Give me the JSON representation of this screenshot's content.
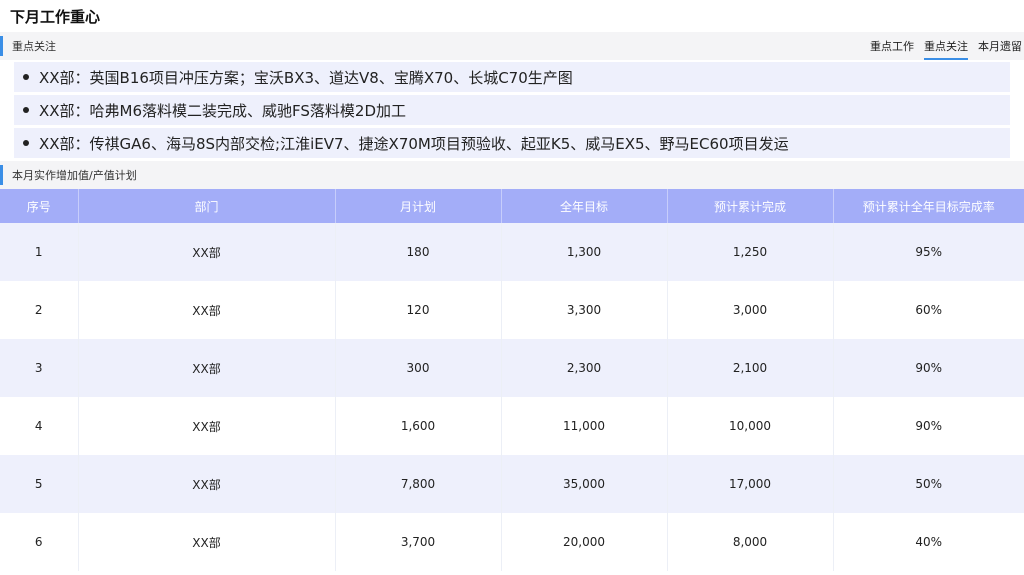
{
  "page": {
    "title": "下月工作重心"
  },
  "focus_section": {
    "label": "重点关注",
    "tabs": [
      {
        "label": "重点工作",
        "active": false
      },
      {
        "label": "重点关注",
        "active": true
      },
      {
        "label": "本月遗留",
        "active": false
      }
    ],
    "items": [
      "XX部：英国B16项目冲压方案；宝沃BX3、道达V8、宝腾X70、长城C70生产图",
      "XX部：哈弗M6落料模二装完成、威驰FS落料模2D加工",
      "XX部：传祺GA6、海马8S内部交检;江淮iEV7、捷途X70M项目预验收、起亚K5、威马EX5、野马EC60项目发运"
    ]
  },
  "plan_section": {
    "label": "本月实作增加值/产值计划",
    "columns": [
      "序号",
      "部门",
      "月计划",
      "全年目标",
      "预计累计完成",
      "预计累计全年目标完成率"
    ],
    "rows": [
      [
        "1",
        "XX部",
        "180",
        "1,300",
        "1,250",
        "95%"
      ],
      [
        "2",
        "XX部",
        "120",
        "3,300",
        "3,000",
        "60%"
      ],
      [
        "3",
        "XX部",
        "300",
        "2,300",
        "2,100",
        "90%"
      ],
      [
        "4",
        "XX部",
        "1,600",
        "11,000",
        "10,000",
        "90%"
      ],
      [
        "5",
        "XX部",
        "7,800",
        "35,000",
        "17,000",
        "50%"
      ],
      [
        "6",
        "XX部",
        "3,700",
        "20,000",
        "8,000",
        "40%"
      ]
    ]
  },
  "colors": {
    "accent": "#3a8ee6",
    "header_bg": "#a3adf8",
    "row_alt_bg": "#eef0fc"
  }
}
